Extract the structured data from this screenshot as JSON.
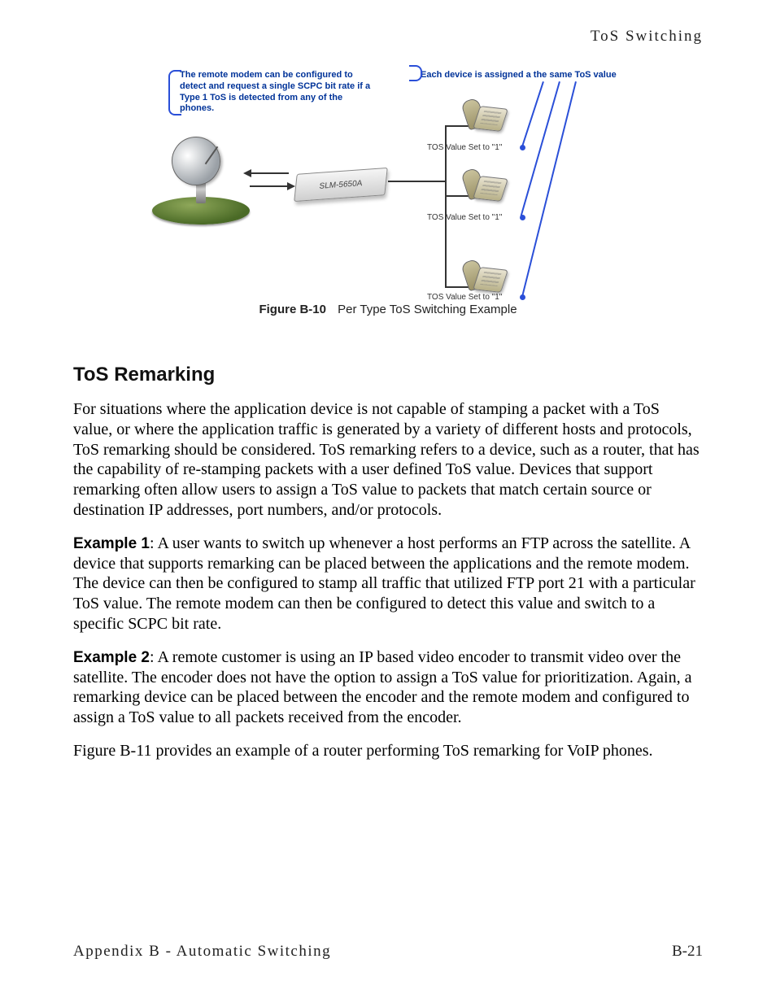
{
  "running_header": "ToS Switching",
  "diagram": {
    "left_note": "The remote modem can be configured to detect and request a single SCPC bit rate if a Type 1 ToS is detected from any of the phones.",
    "right_note": "Each device is assigned a the same ToS value",
    "modem_label": "SLM-5650A",
    "tos_label_1": "TOS Value Set to \"1\"",
    "tos_label_2": "TOS Value Set to \"1\"",
    "tos_label_3": "TOS Value Set to \"1\""
  },
  "figure_caption_label": "Figure B-10",
  "figure_caption_text": "Per Type ToS Switching Example",
  "section_heading": "ToS Remarking",
  "paragraph1": "For situations where the application device is not capable of stamping a packet with a ToS value, or where the application traffic is generated by a variety of different hosts and protocols, ToS remarking should be considered. ToS remarking refers to a device, such as a router, that has the capability of re-stamping packets with a user defined ToS value. Devices that support remarking often allow users to assign a ToS value to packets that match certain source or destination IP addresses, port numbers, and/or protocols.",
  "example1_label": "Example 1",
  "example1_text": ": A user wants to switch up whenever a host performs an FTP across the satellite. A device that supports remarking can be placed between the applications and the remote modem. The device can then be configured to stamp all traffic that utilized FTP port 21 with a particular ToS value. The remote modem can then be configured to detect this value and switch to a specific SCPC bit rate.",
  "example2_label": "Example 2",
  "example2_text": ": A remote customer is using an IP based video encoder to transmit video over the satellite. The encoder does not have the option to assign a ToS value for prioritization. Again, a remarking device can be placed between the encoder and the remote modem and configured to assign a ToS value to all packets received from the encoder.",
  "paragraph_final": "Figure B-11 provides an example of a router performing ToS remarking for VoIP phones.",
  "footer_left": "Appendix B - Automatic Switching",
  "footer_right": "B-21"
}
